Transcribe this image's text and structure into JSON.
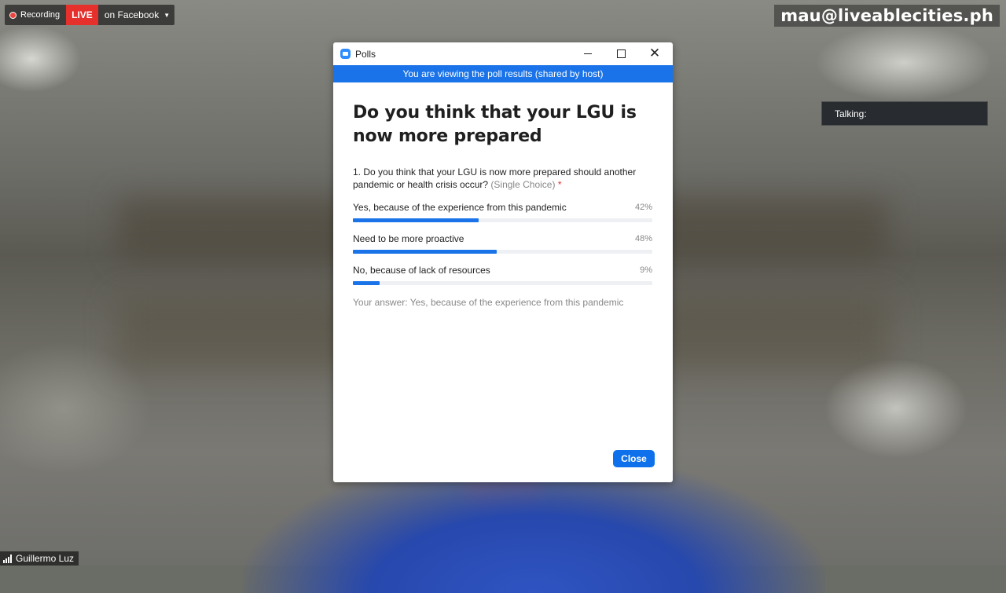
{
  "recording": {
    "label": "Recording",
    "live_label": "LIVE",
    "platform_label": "on Facebook"
  },
  "watermark": "mau@liveablecities.ph",
  "talking_label": "Talking:",
  "participant_name": "Guillermo Luz",
  "poll_window": {
    "title": "Polls",
    "banner": "You are viewing the poll results (shared by host)",
    "poll_title": "Do you think that your LGU is now more prepared",
    "question": "1. Do you think that your LGU is now more prepared should another pandemic or health crisis occur?",
    "question_hint": "(Single Choice)",
    "required_mark": "*",
    "options": [
      {
        "label": "Yes, because of the experience from this pandemic",
        "percent_label": "42%",
        "percent": 42
      },
      {
        "label": "Need to be more proactive",
        "percent_label": "48%",
        "percent": 48
      },
      {
        "label": "No, because of lack of resources",
        "percent_label": "9%",
        "percent": 9
      }
    ],
    "your_answer": "Your answer: Yes, because of the experience from this pandemic",
    "close_button": "Close"
  },
  "colors": {
    "accent": "#1a73e8",
    "live": "#e5302b",
    "button": "#0e71eb"
  }
}
